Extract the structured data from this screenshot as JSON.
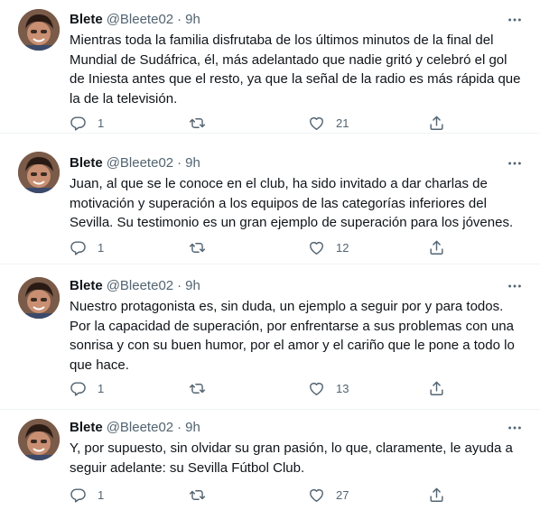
{
  "tweets": [
    {
      "name": "Blete",
      "handle": "@Bleete02",
      "separator": "·",
      "time": "9h",
      "text": "Mientras toda la familia disfrutaba de los últimos minutos de la final del Mundial de Sudáfrica, él, más adelantado que nadie gritó y celebró el gol de Iniesta antes que el resto, ya que la señal de la radio es más rápida que la de la televisión.",
      "replies": "1",
      "retweets": "",
      "likes": "21"
    },
    {
      "name": "Blete",
      "handle": "@Bleete02",
      "separator": "·",
      "time": "9h",
      "text": "Juan, al que se le conoce en el club, ha sido invitado a dar charlas de motivación y superación a los equipos de las categorías inferiores del Sevilla. Su testimonio es un gran ejemplo de superación para los jóvenes.",
      "replies": "1",
      "retweets": "",
      "likes": "12"
    },
    {
      "name": "Blete",
      "handle": "@Bleete02",
      "separator": "·",
      "time": "9h",
      "text": "Nuestro protagonista es, sin duda, un ejemplo a seguir por y para todos. Por la capacidad de superación, por enfrentarse a sus problemas con una sonrisa y con su buen humor, por el amor y el cariño que le pone a todo lo que hace.",
      "replies": "1",
      "retweets": "",
      "likes": "13"
    },
    {
      "name": "Blete",
      "handle": "@Bleete02",
      "separator": "·",
      "time": "9h",
      "text": "Y, por supuesto, sin olvidar su gran pasión, lo que, claramente, le ayuda a seguir adelante: su Sevilla Fútbol Club.",
      "replies": "1",
      "retweets": "",
      "likes": "27"
    }
  ],
  "icons": {
    "more": "more-horizontal-icon",
    "reply": "reply-icon",
    "retweet": "retweet-icon",
    "like": "heart-icon",
    "share": "share-icon"
  },
  "colors": {
    "text_primary": "#0f1419",
    "text_secondary": "#536471",
    "divider": "#eff3f4"
  }
}
